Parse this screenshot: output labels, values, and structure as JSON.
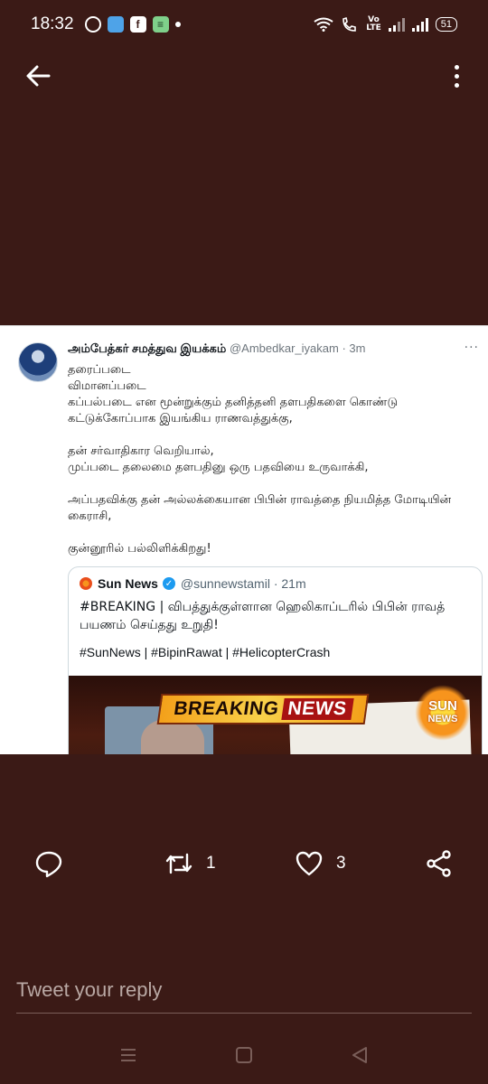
{
  "status_bar": {
    "time": "18:32",
    "battery": "51",
    "volte": "Vo\nLTE"
  },
  "app_bar": {
    "back_icon": "arrow-left-icon",
    "more_icon": "more-vertical-icon"
  },
  "tweet": {
    "author_name": "அம்பேத்கர் சமத்துவ இயக்கம்",
    "author_handle": "@Ambedkar_iyakam",
    "time": "· 3m",
    "more": "···",
    "lines": [
      "தரைப்படை",
      "விமானப்படை",
      "கப்பல்படை என மூன்றுக்கும் தனித்தனி தளபதிகளை கொண்டு",
      "கட்டுக்கோப்பாக இயங்கிய ராணவத்துக்கு,",
      "",
      "தன் சர்வாதிகார வெறியால்,",
      "முப்படை தலைமை தளபதினு ஒரு பதவியை உருவாக்கி,",
      "",
      "அப்பதவிக்கு தன் அல்லக்கையான பிபின் ராவத்தை நியமித்த மோடியின்",
      "கைராசி,",
      "",
      "குன்னூரில் பல்லிளிக்கிறது!"
    ],
    "quoted": {
      "name": "Sun News",
      "handle": "@sunnewstamil · 21m",
      "text": "#BREAKING | விபத்துக்குள்ளான ஹெலிகாப்டரில் பிபின் ராவத் பயணம் செய்தது உறுதி!",
      "tags": "#SunNews | #BipinRawat | #HelicopterCrash",
      "media": {
        "banner_word1": "BREAKING",
        "banner_word2": "NEWS",
        "logo_line1": "SUN",
        "logo_line2": "NEWS"
      }
    }
  },
  "actions": {
    "reply_icon": "comment-icon",
    "retweet_icon": "retweet-icon",
    "retweet_count": "1",
    "like_icon": "heart-icon",
    "like_count": "3",
    "share_icon": "share-icon"
  },
  "reply": {
    "placeholder": "Tweet your reply"
  },
  "nav_bar": {
    "menu_icon": "menu-icon",
    "home_icon": "square-home-icon",
    "back_icon": "triangle-back-icon"
  },
  "colors": {
    "background": "#3b1a16",
    "card": "#ffffff",
    "verified": "#1d9bf0"
  }
}
